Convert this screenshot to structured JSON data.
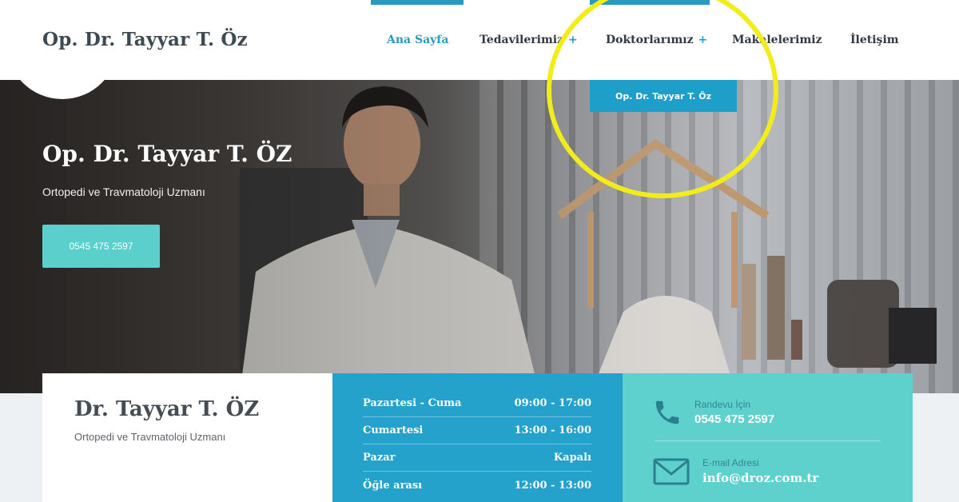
{
  "header": {
    "logo": "Op. Dr. Tayyar T. Öz",
    "nav": [
      {
        "label": "Ana Sayfa",
        "active": true,
        "has_submenu": false
      },
      {
        "label": "Tedavilerimiz",
        "active": false,
        "has_submenu": true
      },
      {
        "label": "Doktorlarımız",
        "active": false,
        "has_submenu": true
      },
      {
        "label": "Makalelerimiz",
        "active": false,
        "has_submenu": false
      },
      {
        "label": "İletişim",
        "active": false,
        "has_submenu": false
      }
    ],
    "submenu_plus": "+",
    "dropdown_item": "Op. Dr. Tayyar T. Öz"
  },
  "hero": {
    "title": "Op. Dr. Tayyar T. ÖZ",
    "subtitle": "Ortopedi ve Travmatoloji Uzmanı",
    "phone_button": "0545 475 2597"
  },
  "info": {
    "name": "Dr. Tayyar T. ÖZ",
    "title": "Ortopedi ve Travmatoloji Uzmanı",
    "hours": [
      {
        "day": "Pazartesi - Cuma",
        "time": "09:00 - 17:00"
      },
      {
        "day": "Cumartesi",
        "time": "13:00 - 16:00"
      },
      {
        "day": "Pazar",
        "time": "Kapalı"
      },
      {
        "day": "Öğle arası",
        "time": "12:00 - 13:00"
      }
    ],
    "appointment_label": "Randevu İçin",
    "appointment_phone": "0545 475 2597",
    "email_label": "E-mail Adresi",
    "email": "info@droz.com.tr"
  },
  "colors": {
    "accent_blue": "#24a2cb",
    "accent_teal": "#5fd1cc",
    "highlight_circle": "#f3ec1d"
  },
  "icons": {
    "phone": "phone-icon",
    "email": "envelope-icon"
  }
}
